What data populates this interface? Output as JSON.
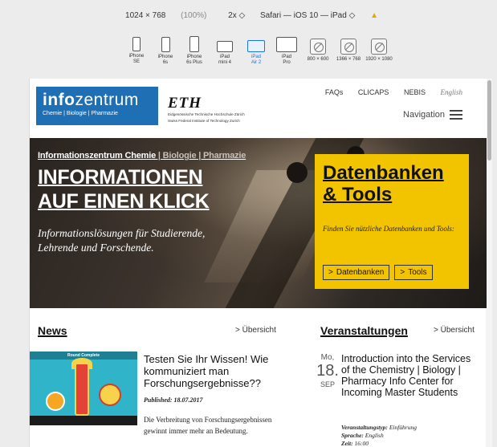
{
  "toolbar": {
    "viewport": "1024 × 768",
    "zoom_pct": "(100%)",
    "scale": "2x ◇",
    "agent": "Safari — iOS 10 — iPad ◇",
    "warn_icon": "warning-icon"
  },
  "devices": [
    {
      "label": "iPhone SE",
      "l1": "iPhone",
      "l2": "SE"
    },
    {
      "label": "iPhone 6s",
      "l1": "iPhone",
      "l2": "6s"
    },
    {
      "label": "iPhone 6s Plus",
      "l1": "iPhone",
      "l2": "6s Plus"
    },
    {
      "label": "iPad mini 4",
      "l1": "iPad",
      "l2": "mini 4"
    },
    {
      "label": "iPad Air 2",
      "l1": "iPad",
      "l2": "Air 2"
    },
    {
      "label": "iPad Pro",
      "l1": "iPad",
      "l2": "Pro"
    },
    {
      "label": "800 × 600",
      "l1": "",
      "l2": "800 × 600"
    },
    {
      "label": "1366 × 768",
      "l1": "",
      "l2": "1366 × 768"
    },
    {
      "label": "1920 × 1080",
      "l1": "",
      "l2": "1920 × 1080"
    }
  ],
  "site": {
    "logo_big_1": "info",
    "logo_big_2": "zentrum",
    "logo_small": "Chemie | Biologie | Pharmazie",
    "eth_mark": "ETH",
    "eth_line1": "Eidgenössische Technische Hochschule Zürich",
    "eth_line2": "Swiss Federal Institute of Technology Zurich",
    "links": [
      "FAQs",
      "CLICAPS",
      "NEBIS"
    ],
    "lang": "English",
    "navigation": "Navigation"
  },
  "hero": {
    "kicker_1": "Informationszentrum Chemie",
    "kicker_2": " | Biologie | Pharmazie",
    "headline_1": "Informationen",
    "headline_2": "auf einen Klick",
    "lead": "Informationslösungen für Studierende, Lehrende und Forschende.",
    "box_title_1": "Datenbanken",
    "box_title_2": "& Tools",
    "box_text": "Finden Sie nützliche Datenbanken und Tools:",
    "btn_db": "Datenbanken",
    "btn_tools": "Tools",
    "arrow": ">"
  },
  "news": {
    "heading": "News",
    "overview": "> Übersicht",
    "img_header": "Round Complete",
    "title": "Testen Sie Ihr Wissen! Wie kommuniziert man Forschungsergebnisse??",
    "published": "Published: 18.07.2017",
    "text": "Die Verbreitung von Forschungsergebnissen gewinnt immer mehr an Bedeutung."
  },
  "events": {
    "heading": "Veranstaltungen",
    "overview": "> Übersicht",
    "day": "Mo,",
    "num": "18.",
    "month": "SEP",
    "title": "Introduction into the Services of the Chemistry | Biology | Pharmacy Info Center for Incoming Master Students",
    "type_label": "Veranstaltungstyp:",
    "type_value": " Einführung",
    "lang_label": "Sprache:",
    "lang_value": " English",
    "time_label": "Zeit:",
    "time_value": " 16:00"
  },
  "colors": {
    "logo_blue": "#1f6fb4",
    "tools_yellow": "#f2c400",
    "active_device": "#1a73e8"
  }
}
